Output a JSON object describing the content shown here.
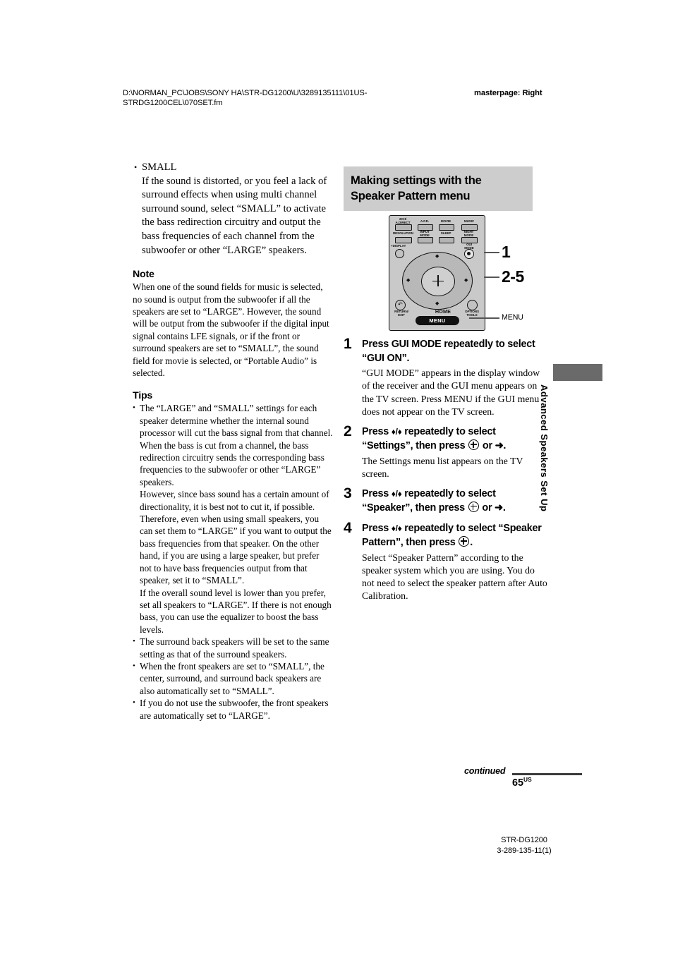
{
  "header": {
    "path": "D:\\NORMAN_PC\\JOBS\\SONY HA\\STR-DG1200\\U\\3289135111\\01US-STRDG1200CEL\\070SET.fm",
    "masterpage": "masterpage: Right"
  },
  "left_column": {
    "bullet": {
      "title": "SMALL",
      "body": "If the sound is distorted, or you feel a lack of surround effects when using multi channel surround sound, select “SMALL” to activate the bass redirection circuitry and output the bass frequencies of each channel from the subwoofer or other “LARGE” speakers."
    },
    "note": {
      "heading": "Note",
      "body": "When one of the sound fields for music is selected, no sound is output from the subwoofer if all the speakers are set to “LARGE”. However, the sound will be output from the subwoofer if the digital input signal contains LFE signals, or if the front or surround speakers are set to “SMALL”, the sound field for movie is selected, or “Portable Audio” is selected."
    },
    "tips": {
      "heading": "Tips",
      "items": [
        "The “LARGE” and “SMALL” settings for each speaker determine whether the internal sound processor will cut the bass signal from that channel.",
        "The surround back speakers will be set to the same setting as that of the surround speakers.",
        "When the front speakers are set to “SMALL”, the center, surround, and surround back speakers are also automatically set to “SMALL”.",
        "If you do not use the subwoofer, the front speakers are automatically set to “LARGE”."
      ],
      "paragraphs": [
        "When the bass is cut from a channel, the bass redirection circuitry sends the corresponding bass frequencies to the subwoofer or other “LARGE” speakers.",
        "However, since bass sound has a certain amount of directionality, it is best not to cut it, if possible. Therefore, even when using small speakers, you can set them to “LARGE” if you want to output the bass frequencies from that speaker. On the other hand, if you are using a large speaker, but prefer not to have bass frequencies output from that speaker, set it to “SMALL”.",
        "If the overall sound level is lower than you prefer, set all speakers to “LARGE”. If there is not enough bass, you can use the equalizer to boost the bass levels."
      ]
    }
  },
  "right_column": {
    "section_title": "Making settings with the Speaker Pattern menu",
    "remote": {
      "buttons": [
        "2CH/\nA.DIRECT",
        "A.F.D.",
        "MOVIE",
        "MUSIC",
        "RESOLUTION",
        "INPUT\nMODE",
        "SLEEP",
        "NIGHT\nMODE",
        "+DISPLAY",
        "GUI\nMODE",
        "RETURN/\nEXIT",
        "OPTIONS\nTOOLS",
        "HOME",
        "MENU"
      ],
      "callouts": [
        {
          "label": "1"
        },
        {
          "label": "2-5"
        },
        {
          "label": "MENU"
        }
      ]
    },
    "steps": [
      {
        "num": "1",
        "head_parts": [
          "Press GUI MODE repeatedly to select “GUI ON”."
        ],
        "body": "“GUI MODE” appears in the display window of the receiver and the GUI menu appears on the TV screen. Press MENU if the GUI menu does not appear on the TV screen."
      },
      {
        "num": "2",
        "head_pre": "Press ",
        "head_arrows": "♦/♦",
        "head_mid": " repeatedly to select “Settings”, then press ",
        "head_post": " or ➜.",
        "body": "The Settings menu list appears on the TV screen."
      },
      {
        "num": "3",
        "head_pre": "Press ",
        "head_arrows": "♦/♦",
        "head_mid": " repeatedly to select “Speaker”, then press ",
        "head_post": " or ➜.",
        "body": ""
      },
      {
        "num": "4",
        "head_pre": "Press ",
        "head_arrows": "♦/♦",
        "head_mid": " repeatedly to select “Speaker Pattern”, then press ",
        "head_post": ".",
        "body": "Select “Speaker Pattern” according to the speaker system which you are using. You do not need to select the speaker pattern after Auto Calibration."
      }
    ]
  },
  "side_tab": {
    "label": "Advanced Speakers Set Up",
    "bar_color": "#6a6a6a"
  },
  "footer": {
    "continued": "continued",
    "page_number": "65",
    "page_suffix": "US",
    "model": "STR-DG1200",
    "part_prefix": "3-289-135-",
    "part_bold": "11",
    "part_suffix": "(1)"
  }
}
